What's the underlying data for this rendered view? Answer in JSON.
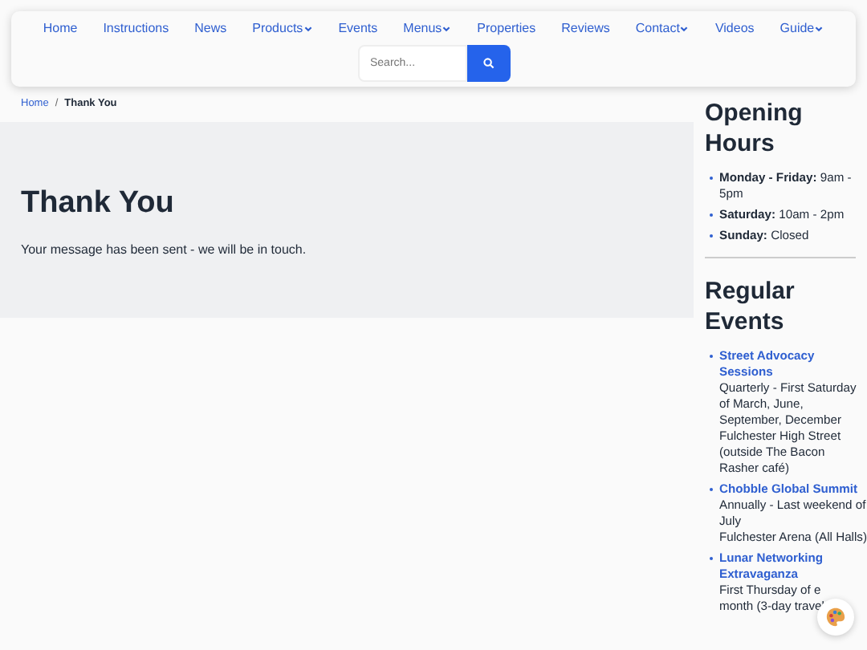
{
  "nav": {
    "items": [
      {
        "label": "Home",
        "dropdown": false
      },
      {
        "label": "Instructions",
        "dropdown": false
      },
      {
        "label": "News",
        "dropdown": false
      },
      {
        "label": "Products",
        "dropdown": true
      },
      {
        "label": "Events",
        "dropdown": false
      },
      {
        "label": "Menus",
        "dropdown": true
      },
      {
        "label": "Properties",
        "dropdown": false
      },
      {
        "label": "Reviews",
        "dropdown": false
      },
      {
        "label": "Contact",
        "dropdown": true
      },
      {
        "label": "Videos",
        "dropdown": false
      },
      {
        "label": "Guide",
        "dropdown": true
      }
    ],
    "search": {
      "placeholder": "Search..."
    }
  },
  "breadcrumb": {
    "separator": "/",
    "items": [
      {
        "label": "Home",
        "current": false
      },
      {
        "label": "Thank You",
        "current": true
      }
    ]
  },
  "hero": {
    "title": "Thank You",
    "message": "Your message has been sent - we will be in touch."
  },
  "opening_hours": {
    "title": "Opening Hours",
    "items": [
      {
        "text": "**Monday - Friday:** 9am - 5pm"
      },
      {
        "text": "**Saturday:** 10am - 2pm"
      },
      {
        "text": "**Sunday:** Closed"
      }
    ]
  },
  "regular_events": {
    "title": "Regular Events",
    "items": [
      {
        "name": "Street Advocacy Sessions",
        "lines": [
          "Quarterly - First Saturday of March, June, September, December",
          "Fulchester High Street (outside The Bacon Rasher café)"
        ]
      },
      {
        "name": "Chobble Global Summit",
        "lines": [
          "Annually - Last weekend of July",
          "Fulchester Arena (All Halls)"
        ]
      },
      {
        "name": "Lunar Networking Extravaganza",
        "lines": [
          "First Thursday of e",
          "month (3-day travel"
        ]
      }
    ]
  }
}
